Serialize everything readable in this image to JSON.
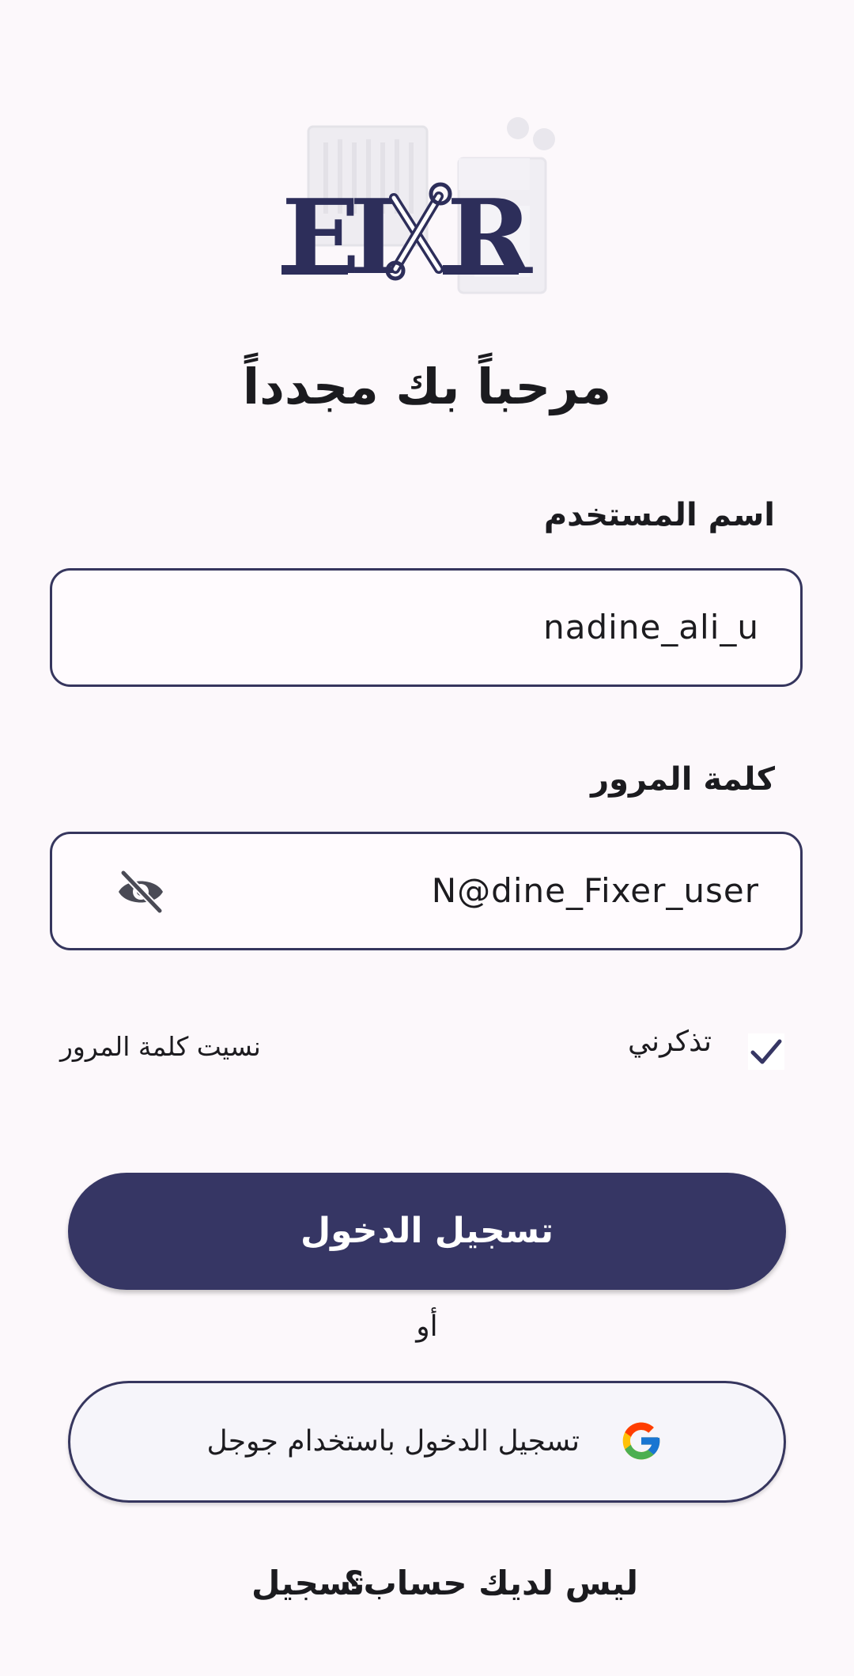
{
  "logo": {
    "text": "FIXR"
  },
  "title": "مرحباً بك مجدداً",
  "username": {
    "label": "اسم المستخدم",
    "value": "nadine_ali_u"
  },
  "password": {
    "label": "كلمة المرور",
    "value": "N@dine_Fixer_user",
    "visibility_icon": "eye-off-icon"
  },
  "remember_me": {
    "label": "تذكرني",
    "checked": true
  },
  "forgot_password": "نسيت كلمة المرور",
  "login_button": "تسجيل الدخول",
  "or_text": "أو",
  "google_button": {
    "label": "تسجيل الدخول باستخدام جوجل",
    "icon": "google-icon"
  },
  "footer": {
    "no_account": "ليس لديك حساب؟",
    "signup": "تسجيل"
  },
  "colors": {
    "primary": "#363664",
    "background": "#fcf8fb",
    "border": "#36365e"
  }
}
